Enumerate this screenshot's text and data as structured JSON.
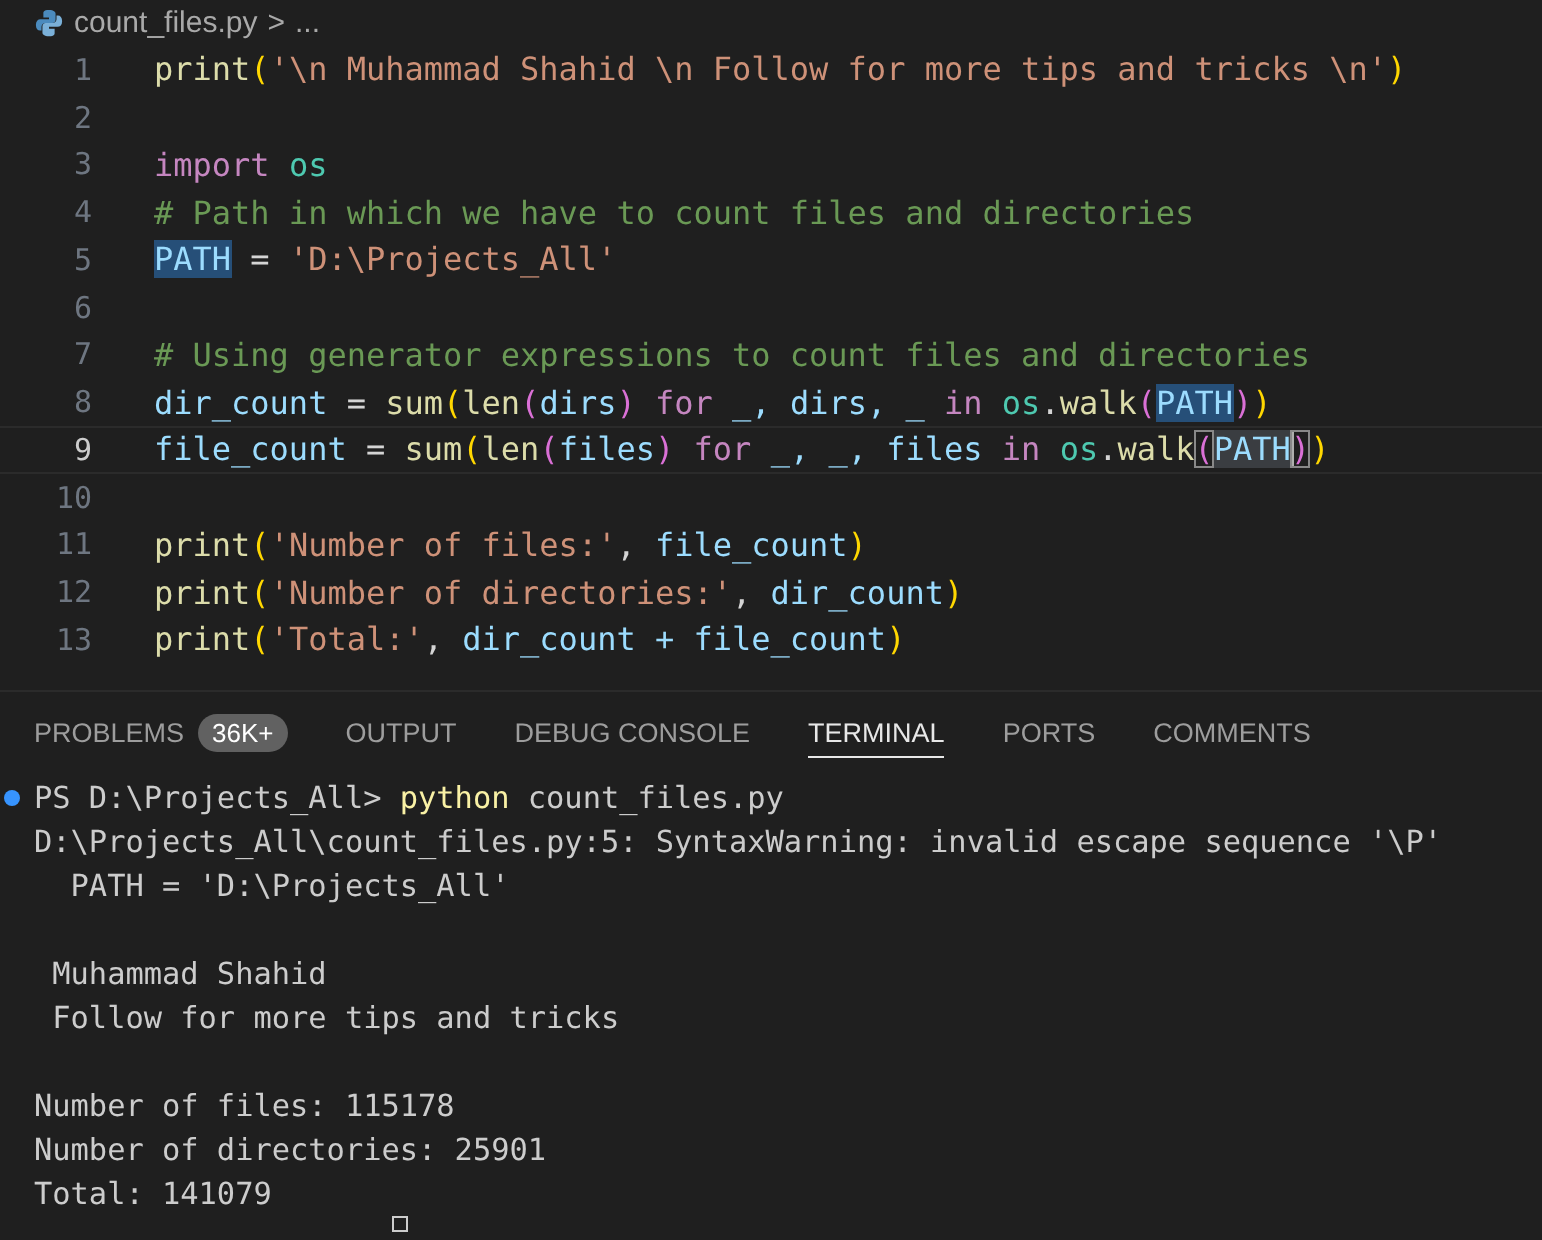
{
  "breadcrumb": {
    "file": "count_files.py",
    "separator": ">",
    "rest": "..."
  },
  "editor": {
    "lines": [
      {
        "number": "1",
        "current": false,
        "tokens": [
          {
            "text": "print",
            "kind": "func"
          },
          {
            "text": "(",
            "kind": "paren1"
          },
          {
            "text": "'\\n Muhammad Shahid \\n Follow for more tips and tricks \\n'",
            "kind": "string"
          },
          {
            "text": ")",
            "kind": "paren1"
          }
        ]
      },
      {
        "number": "2",
        "current": false
      },
      {
        "number": "3",
        "current": false,
        "tokens": [
          {
            "text": "import ",
            "kind": "keyword"
          },
          {
            "text": "os",
            "kind": "module"
          }
        ]
      },
      {
        "number": "4",
        "current": false,
        "tokens": [
          {
            "text": "# Path in which we have to count files and directories",
            "kind": "comment"
          }
        ]
      },
      {
        "number": "5",
        "current": false,
        "tokens": [
          {
            "text": "PATH",
            "kind": "var_match"
          },
          {
            "text": " = ",
            "kind": "op"
          },
          {
            "text": "'D:\\Projects_All'",
            "kind": "string"
          }
        ]
      },
      {
        "number": "6",
        "current": false
      },
      {
        "number": "7",
        "current": false,
        "tokens": [
          {
            "text": "# Using generator expressions to count files and directories",
            "kind": "comment"
          }
        ]
      },
      {
        "number": "8",
        "current": false,
        "tokens": [
          {
            "text": "dir_count",
            "kind": "var"
          },
          {
            "text": " = ",
            "kind": "op"
          },
          {
            "text": "sum",
            "kind": "func"
          },
          {
            "text": "(",
            "kind": "paren1"
          },
          {
            "text": "len",
            "kind": "func"
          },
          {
            "text": "(",
            "kind": "paren2"
          },
          {
            "text": "dirs",
            "kind": "var"
          },
          {
            "text": ")",
            "kind": "paren2"
          },
          {
            "text": " for ",
            "kind": "keyword"
          },
          {
            "text": "_, dirs, _ ",
            "kind": "var"
          },
          {
            "text": "in ",
            "kind": "keyword"
          },
          {
            "text": "os",
            "kind": "module"
          },
          {
            "text": ".",
            "kind": "op"
          },
          {
            "text": "walk",
            "kind": "func"
          },
          {
            "text": "(",
            "kind": "paren2"
          },
          {
            "text": "PATH",
            "kind": "var_match"
          },
          {
            "text": ")",
            "kind": "paren2"
          },
          {
            "text": ")",
            "kind": "paren1"
          }
        ]
      },
      {
        "number": "9",
        "current": true,
        "tokens": [
          {
            "text": "file_count",
            "kind": "var"
          },
          {
            "text": " = ",
            "kind": "op"
          },
          {
            "text": "sum",
            "kind": "func"
          },
          {
            "text": "(",
            "kind": "paren1"
          },
          {
            "text": "len",
            "kind": "func"
          },
          {
            "text": "(",
            "kind": "paren2"
          },
          {
            "text": "files",
            "kind": "var"
          },
          {
            "text": ")",
            "kind": "paren2"
          },
          {
            "text": " for ",
            "kind": "keyword"
          },
          {
            "text": "_, _, files ",
            "kind": "var"
          },
          {
            "text": "in ",
            "kind": "keyword"
          },
          {
            "text": "os",
            "kind": "module"
          },
          {
            "text": ".",
            "kind": "op"
          },
          {
            "text": "walk",
            "kind": "func"
          },
          {
            "text": "(",
            "kind": "paren2_match"
          },
          {
            "text": "PATH",
            "kind": "var_match"
          },
          {
            "text": ")",
            "kind": "paren2_match_cursor"
          },
          {
            "text": ")",
            "kind": "paren1"
          }
        ]
      },
      {
        "number": "10",
        "current": false
      },
      {
        "number": "11",
        "current": false,
        "tokens": [
          {
            "text": "print",
            "kind": "func"
          },
          {
            "text": "(",
            "kind": "paren1"
          },
          {
            "text": "'Number of files:'",
            "kind": "string"
          },
          {
            "text": ", ",
            "kind": "op"
          },
          {
            "text": "file_count",
            "kind": "var"
          },
          {
            "text": ")",
            "kind": "paren1"
          }
        ]
      },
      {
        "number": "12",
        "current": false,
        "tokens": [
          {
            "text": "print",
            "kind": "func"
          },
          {
            "text": "(",
            "kind": "paren1"
          },
          {
            "text": "'Number of directories:'",
            "kind": "string"
          },
          {
            "text": ", ",
            "kind": "op"
          },
          {
            "text": "dir_count",
            "kind": "var"
          },
          {
            "text": ")",
            "kind": "paren1"
          }
        ]
      },
      {
        "number": "13",
        "current": false,
        "tokens": [
          {
            "text": "print",
            "kind": "func"
          },
          {
            "text": "(",
            "kind": "paren1"
          },
          {
            "text": "'Total:'",
            "kind": "string"
          },
          {
            "text": ", ",
            "kind": "op"
          },
          {
            "text": "dir_count + file_count",
            "kind": "var"
          },
          {
            "text": ")",
            "kind": "paren1"
          }
        ]
      }
    ]
  },
  "panel": {
    "tabs": [
      {
        "label": "PROBLEMS",
        "badge": "36K+",
        "selected": false
      },
      {
        "label": "OUTPUT",
        "selected": false
      },
      {
        "label": "DEBUG CONSOLE",
        "selected": false
      },
      {
        "label": "TERMINAL",
        "selected": true
      },
      {
        "label": "PORTS",
        "selected": false
      },
      {
        "label": "COMMENTS",
        "selected": false
      }
    ],
    "terminal": {
      "blocks": [
        [
          {
            "kind": "prompt",
            "prompt": "PS D:\\Projects_All> ",
            "command": "python",
            "args": " count_files.py"
          },
          {
            "kind": "output",
            "text": "D:\\Projects_All\\count_files.py:5: SyntaxWarning: invalid escape sequence '\\P'"
          },
          {
            "kind": "output",
            "text": "  PATH = 'D:\\Projects_All'"
          }
        ],
        [
          {
            "kind": "output",
            "text": " Muhammad Shahid"
          },
          {
            "kind": "output",
            "text": " Follow for more tips and tricks"
          }
        ],
        [
          {
            "kind": "output",
            "text": "Number of files: 115178"
          },
          {
            "kind": "output",
            "text": "Number of directories: 25901"
          },
          {
            "kind": "output",
            "text": "Total: 141079"
          }
        ]
      ]
    }
  }
}
